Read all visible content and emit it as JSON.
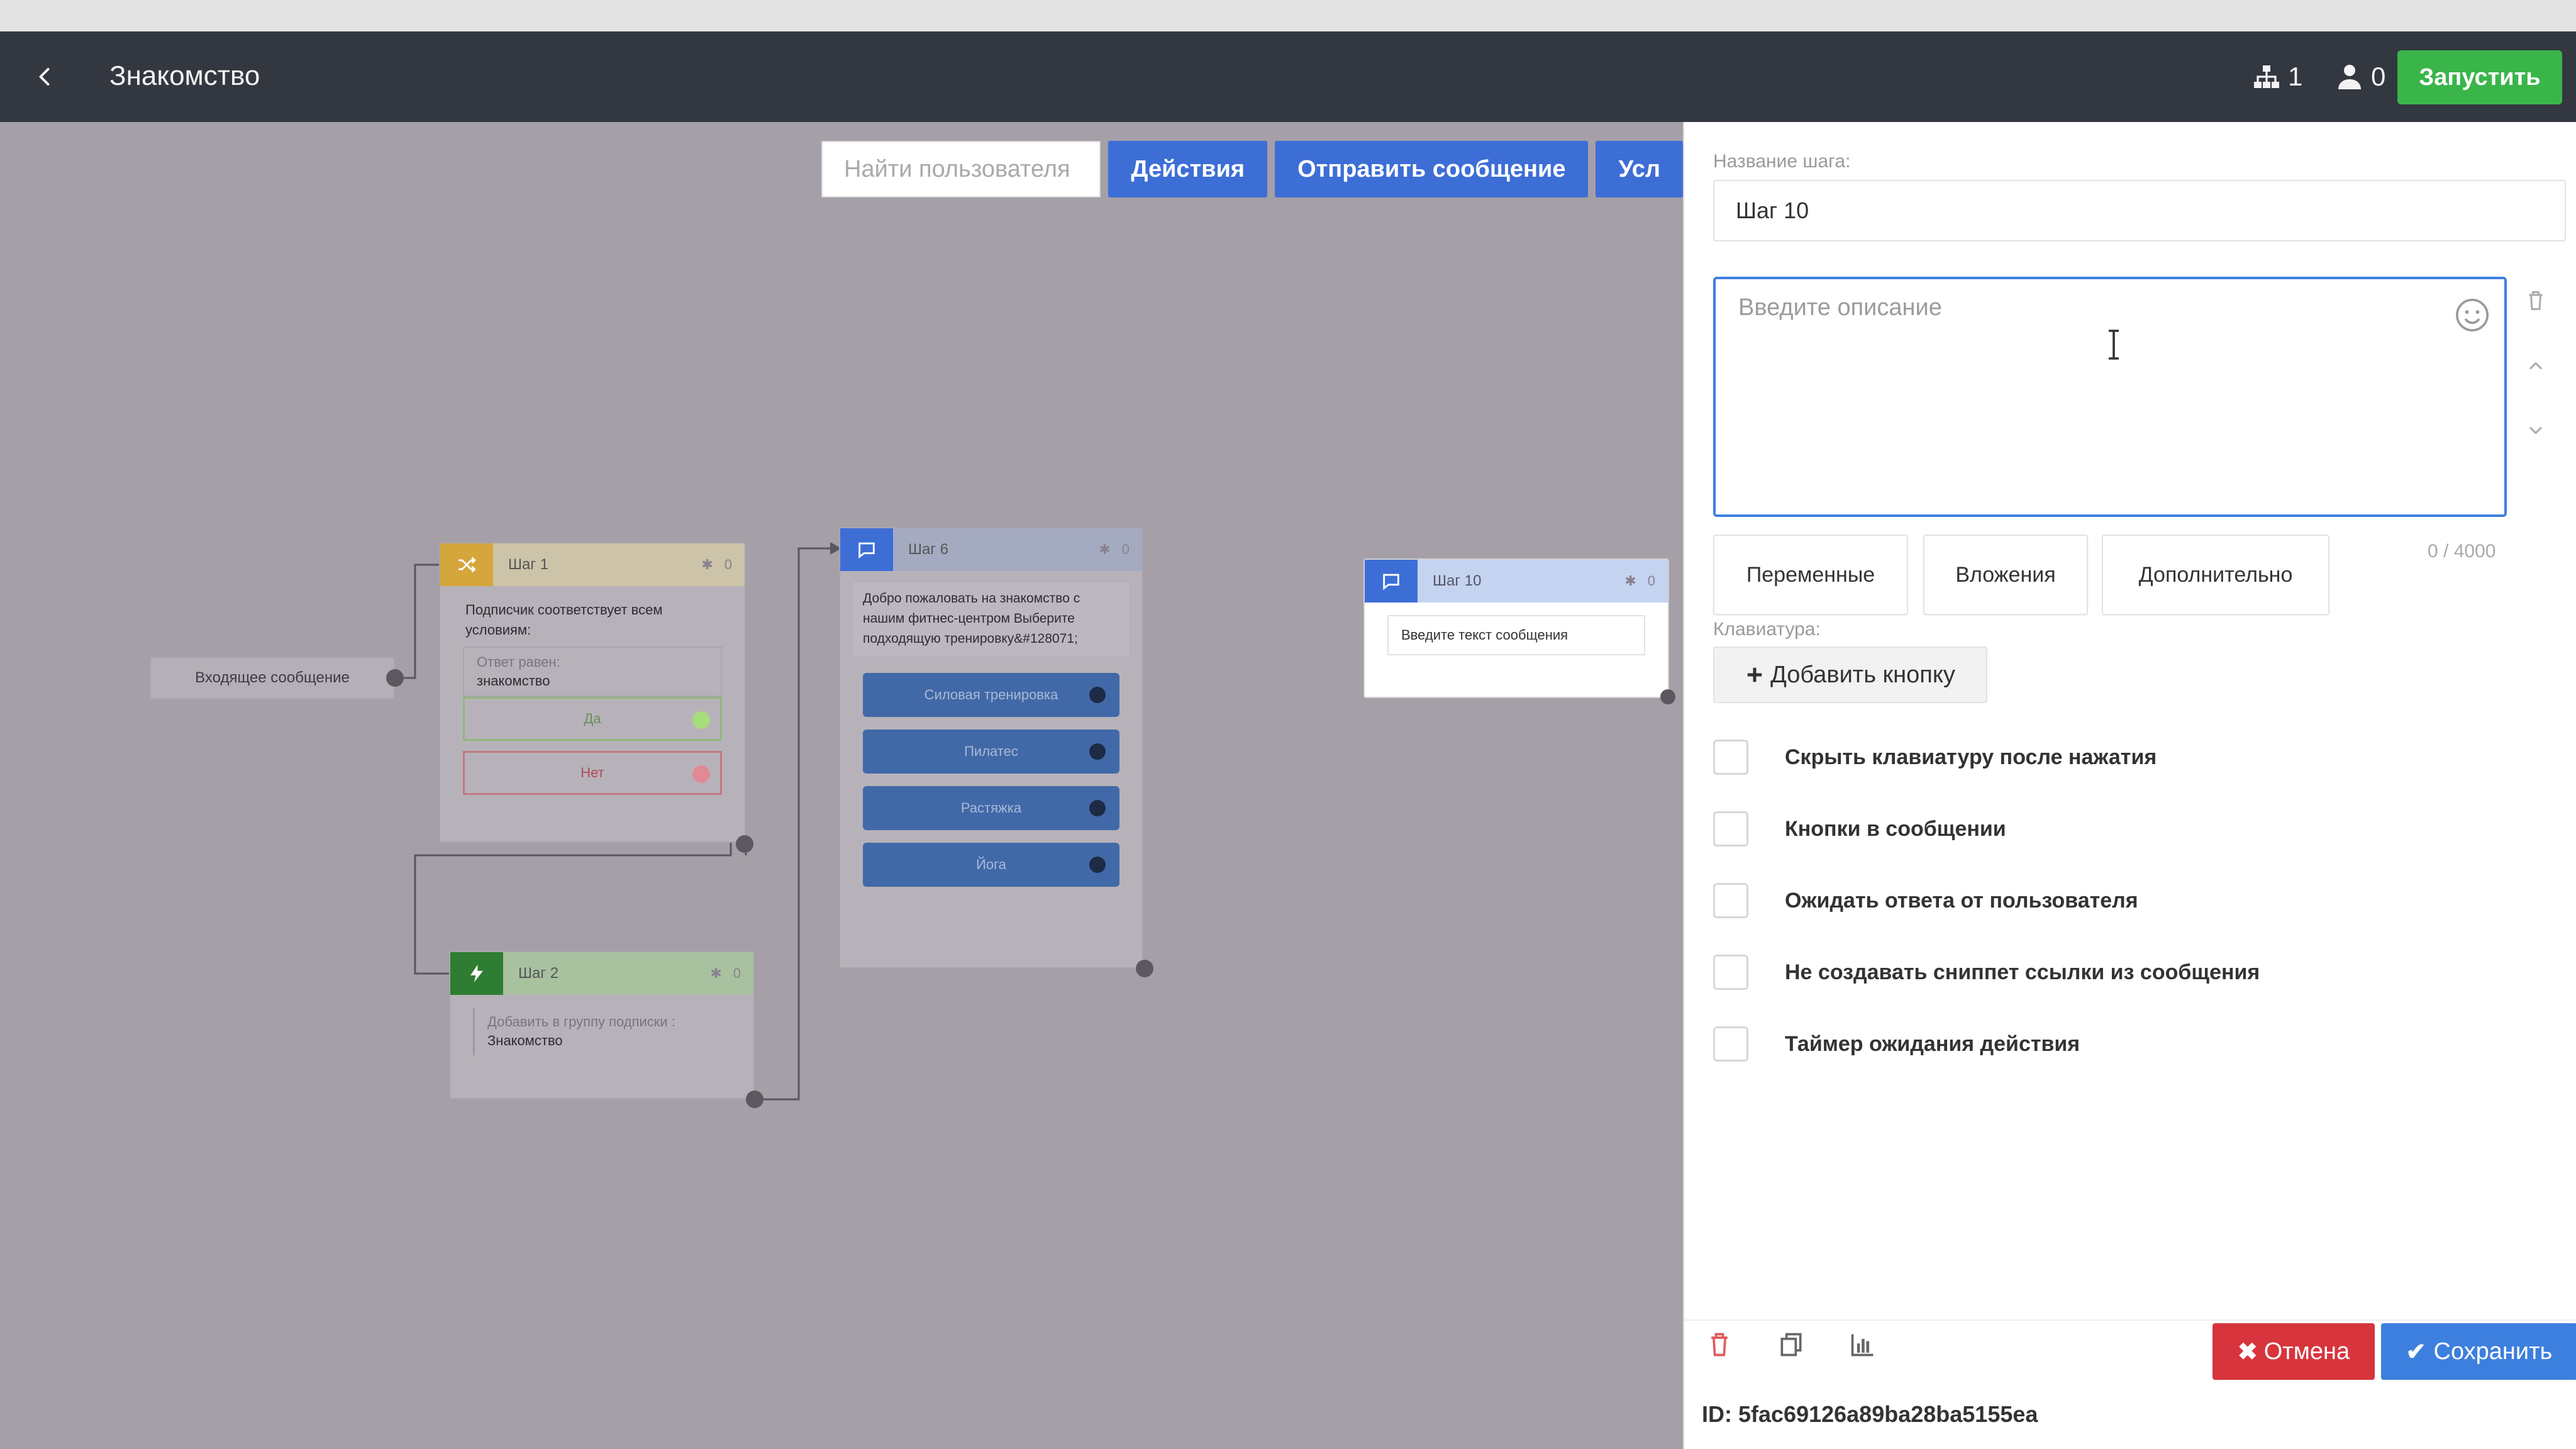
{
  "header": {
    "title": "Знакомство",
    "stat_structure": "1",
    "stat_users": "0",
    "run_label": "Запустить"
  },
  "toolbar": {
    "search_placeholder": "Найти пользователя",
    "actions_label": "Действия",
    "send_message_label": "Отправить сообщение",
    "conditions_label": "Усл"
  },
  "canvas": {
    "incoming_label": "Входящее сообщение",
    "step1": {
      "title": "Шаг 1",
      "text": "Подписчик соответствует всем условиям:",
      "cond_label": "Ответ равен:",
      "cond_value": "знакомство",
      "yes_label": "Да",
      "no_label": "Нет"
    },
    "step2": {
      "title": "Шаг 2",
      "action_label": "Добавить в группу подписки :",
      "action_value": "Знакомство"
    },
    "step6": {
      "title": "Шаг 6",
      "text": "Добро пожаловать на знакомство с нашим фитнес-центром Выберите подходящую тренировку&#128071;",
      "options": [
        "Силовая тренировка",
        "Пилатес",
        "Растяжка",
        "Йога"
      ]
    },
    "step10": {
      "title": "Шаг 10",
      "input_text": "Введите текст сообщения"
    }
  },
  "panel": {
    "step_name_label": "Название шага:",
    "step_name_value": "Шаг 10",
    "description_placeholder": "Введите описание",
    "char_count": "0 / 4000",
    "tabs": [
      "Переменные",
      "Вложения",
      "Дополнительно"
    ],
    "keyboard_label": "Клавиатура:",
    "add_button_label": "Добавить кнопку",
    "options": [
      "Скрыть клавиатуру после нажатия",
      "Кнопки в сообщении",
      "Ожидать ответа от пользователя",
      "Не создавать сниппет ссылки из сообщения",
      "Таймер ожидания действия"
    ],
    "cancel_label": "Отмена",
    "save_label": "Сохранить",
    "id_text": "ID: 5fac69126a89ba28ba5155ea"
  },
  "colors": {
    "header_bg": "#333740",
    "run_green": "#39b54a",
    "accent_blue": "#3d6ed6",
    "cancel_red": "#d8343d",
    "yes_green": "#6fbf4b",
    "no_red": "#d06060"
  }
}
